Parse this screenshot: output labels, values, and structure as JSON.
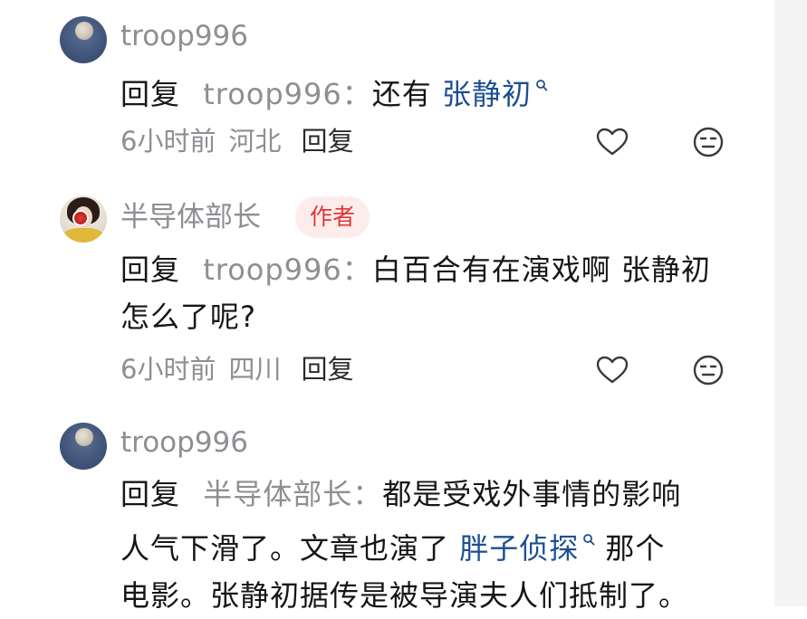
{
  "comments": [
    {
      "username": "troop996",
      "reply_prefix": "回复",
      "reply_to": "troop996",
      "colon": "：",
      "text_before_link": "还有 ",
      "link_text": "张静初",
      "text_lines": [],
      "time": "6小时前",
      "location": "河北",
      "reply_label": "回复",
      "avatar": "moon-avatar"
    },
    {
      "username": "半导体部长",
      "author_badge": "作者",
      "reply_prefix": "回复",
      "reply_to": "troop996",
      "colon": "：",
      "line1_rest": "白百合有在演戏啊 张静初",
      "line2": "怎么了呢?",
      "time": "6小时前",
      "location": "四川",
      "reply_label": "回复",
      "avatar": "portrait-avatar"
    },
    {
      "username": "troop996",
      "reply_prefix": "回复",
      "reply_to": "半导体部长",
      "colon": "：",
      "line1_rest": "都是受戏外事情的影响",
      "line2_before_link": "人气下滑了。文章也演了 ",
      "link_text": "胖子侦探",
      "line2_after_link": " 那个",
      "line3": "电影。张静初据传是被导演夫人们抵制了。",
      "avatar": "moon-avatar"
    }
  ],
  "icons": {
    "like": "heart-outline-icon",
    "react": "neutral-face-icon",
    "search": "search-icon"
  },
  "colors": {
    "link": "#1d4f91",
    "muted": "#8e8e93",
    "badge_bg": "#fdecec",
    "badge_text": "#e23535"
  }
}
